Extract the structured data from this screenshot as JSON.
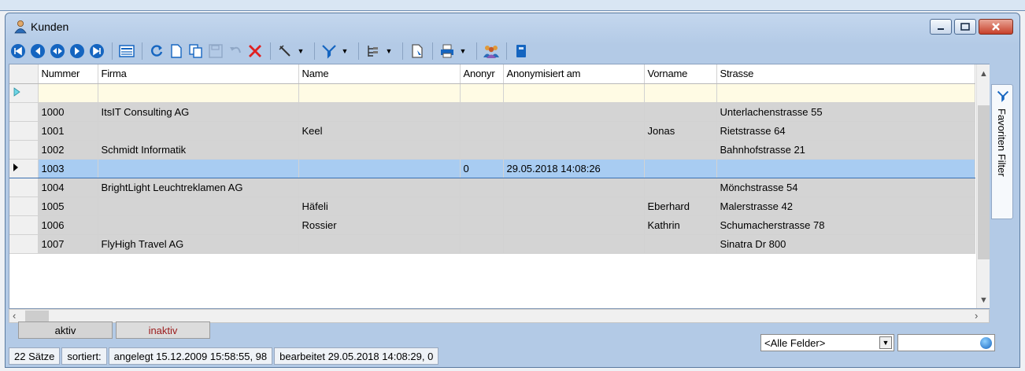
{
  "window": {
    "title": "Kunden"
  },
  "grid": {
    "columns": [
      "Nummer",
      "Firma",
      "Name",
      "Anonyr",
      "Anonymisiert am",
      "Vorname",
      "Strasse"
    ],
    "rows": [
      [
        "1000",
        "ItsIT Consulting AG",
        "",
        "",
        "",
        "",
        "Unterlachenstrasse 55"
      ],
      [
        "1001",
        "",
        "Keel",
        "",
        "",
        "Jonas",
        "Rietstrasse 64"
      ],
      [
        "1002",
        "Schmidt Informatik",
        "",
        "",
        "",
        "",
        "Bahnhofstrasse 21"
      ],
      [
        "1003",
        "",
        "",
        "0",
        "29.05.2018 14:08:26",
        "",
        ""
      ],
      [
        "1004",
        "BrightLight Leuchtreklamen AG",
        "",
        "",
        "",
        "",
        "Mönchstrasse 54"
      ],
      [
        "1005",
        "",
        "Häfeli",
        "",
        "",
        "Eberhard",
        "Malerstrasse 42"
      ],
      [
        "1006",
        "",
        "Rossier",
        "",
        "",
        "Kathrin",
        "Schumacherstrasse 78"
      ],
      [
        "1007",
        "FlyHigh Travel AG",
        "",
        "",
        "",
        "",
        "Sinatra Dr 800"
      ]
    ],
    "selected_row": 3
  },
  "side_panel": {
    "label": "Favoriten Filter"
  },
  "tabs": {
    "aktiv": "aktiv",
    "inaktiv": "inaktiv"
  },
  "status": {
    "count": "22 Sätze",
    "sorted": "sortiert:",
    "created": "angelegt 15.12.2009 15:58:55, 98",
    "edited": "bearbeitet 29.05.2018 14:08:29,  0",
    "field_select": "<Alle Felder>",
    "search_value": ""
  },
  "colors": {
    "accent": "#1565c0",
    "selection": "#a8ccf2",
    "inaktiv_text": "#9b1b1b",
    "delete_red": "#e02020"
  }
}
